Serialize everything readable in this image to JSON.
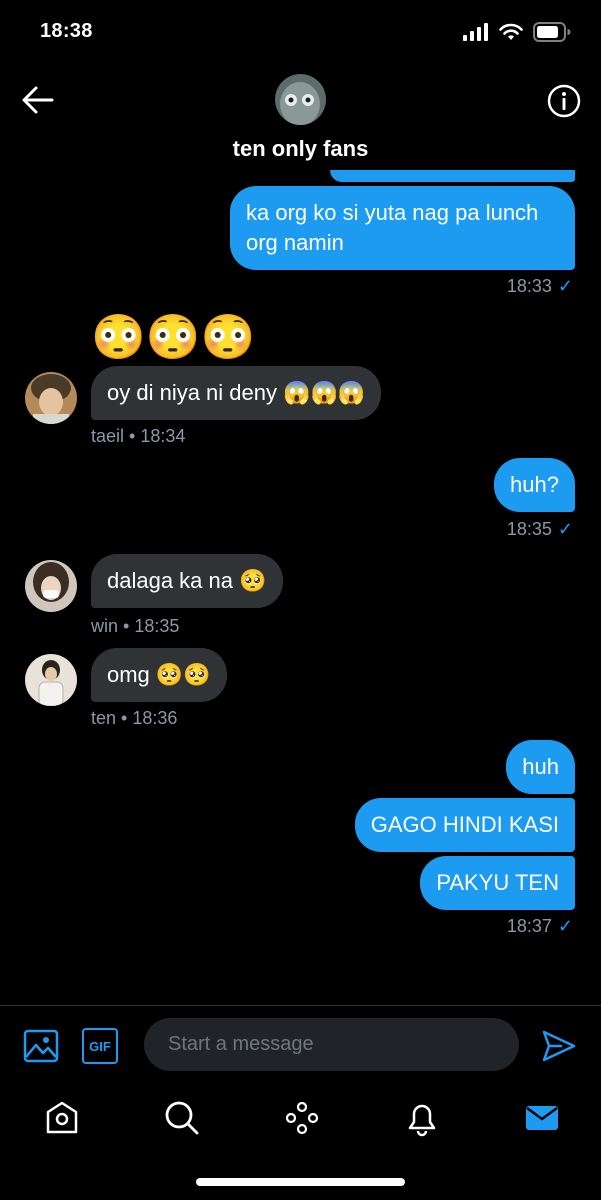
{
  "status_bar": {
    "time": "18:38"
  },
  "header": {
    "title": "ten only fans"
  },
  "messages": [
    {
      "text": "ka org ko si yuta nag pa lunch org namin",
      "time": "18:33"
    },
    {
      "emoji": "😳😳😳"
    },
    {
      "text": "oy di niya ni deny 😱😱😱",
      "sender": "taeil",
      "time": "18:34"
    },
    {
      "text": "huh?",
      "time": "18:35"
    },
    {
      "text": "dalaga ka na 🥺",
      "sender": "win",
      "time": "18:35"
    },
    {
      "text": "omg 🥺🥺",
      "sender": "ten",
      "time": "18:36"
    },
    {
      "text": "huh"
    },
    {
      "text": "GAGO HINDI KASI"
    },
    {
      "text": "PAKYU TEN",
      "time": "18:37"
    }
  ],
  "composer": {
    "placeholder": "Start a message",
    "gif_label": "GIF"
  },
  "colors": {
    "accent": "#1d9bf0",
    "received_bubble": "#2f3336",
    "meta_text": "#8b98a5",
    "background": "#000000"
  }
}
